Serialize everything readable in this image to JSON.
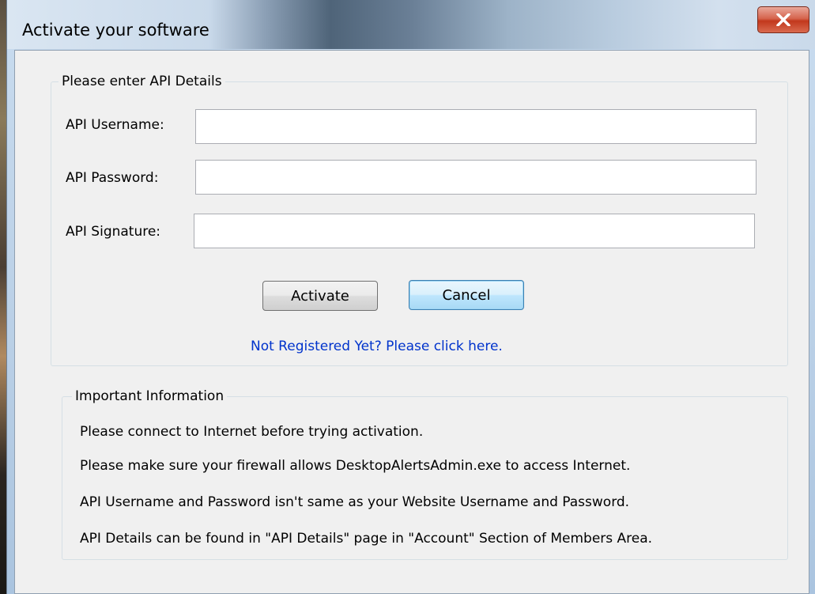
{
  "window": {
    "title": "Activate your software",
    "close_icon": "close-icon"
  },
  "api_details": {
    "group_title": "Please enter API Details",
    "username_label": "API Username:",
    "username_value": "",
    "password_label": "API Password:",
    "password_value": "",
    "signature_label": "API Signature:",
    "signature_value": "",
    "activate_label": "Activate",
    "cancel_label": "Cancel",
    "register_link": "Not Registered Yet? Please click here."
  },
  "important_info": {
    "group_title": "Important Information",
    "lines": [
      "Please connect to Internet before trying activation.",
      "Please make sure your firewall allows DesktopAlertsAdmin.exe to access Internet.",
      "API Username and Password isn't same as your Website Username and Password.",
      "API Details can be found in \"API Details\" page in \"Account\" Section of Members Area."
    ]
  },
  "colors": {
    "link": "#0033cc",
    "close_button": "#c2381c",
    "dialog_background": "#f0f0f0"
  }
}
